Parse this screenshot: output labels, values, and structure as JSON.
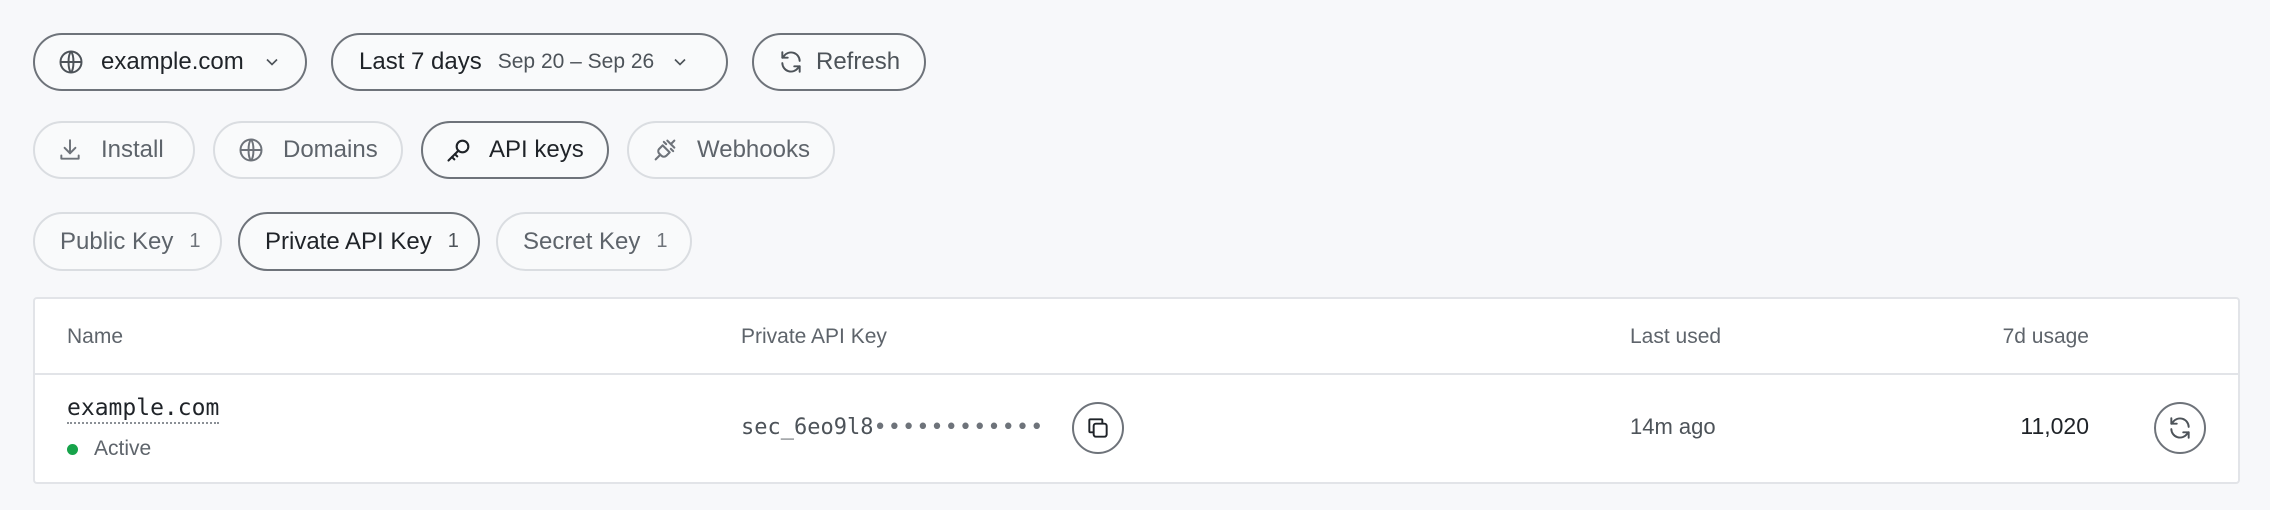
{
  "toolbar": {
    "domain_select": "example.com",
    "range_label": "Last 7 days",
    "range_dates": "Sep 20 – Sep 26",
    "refresh_label": "Refresh"
  },
  "nav_tabs": [
    {
      "label": "Install",
      "icon": "download-icon"
    },
    {
      "label": "Domains",
      "icon": "globe-icon"
    },
    {
      "label": "API keys",
      "icon": "key-icon",
      "active": true
    },
    {
      "label": "Webhooks",
      "icon": "plug-icon"
    }
  ],
  "key_tabs": [
    {
      "label": "Public Key",
      "count": "1"
    },
    {
      "label": "Private API Key",
      "count": "1",
      "active": true
    },
    {
      "label": "Secret Key",
      "count": "1"
    }
  ],
  "table": {
    "headers": {
      "name": "Name",
      "key": "Private API Key",
      "last_used": "Last used",
      "usage": "7d usage"
    },
    "rows": [
      {
        "name": "example.com",
        "status": "Active",
        "key_prefix": "sec_6eo9l8",
        "key_mask": "••••••••••••",
        "last_used": "14m ago",
        "usage": "11,020"
      }
    ]
  },
  "colors": {
    "background": "#f7f8fa",
    "border_active": "#6e737a",
    "border_soft": "#dadde1",
    "status_active": "#16a34a"
  }
}
